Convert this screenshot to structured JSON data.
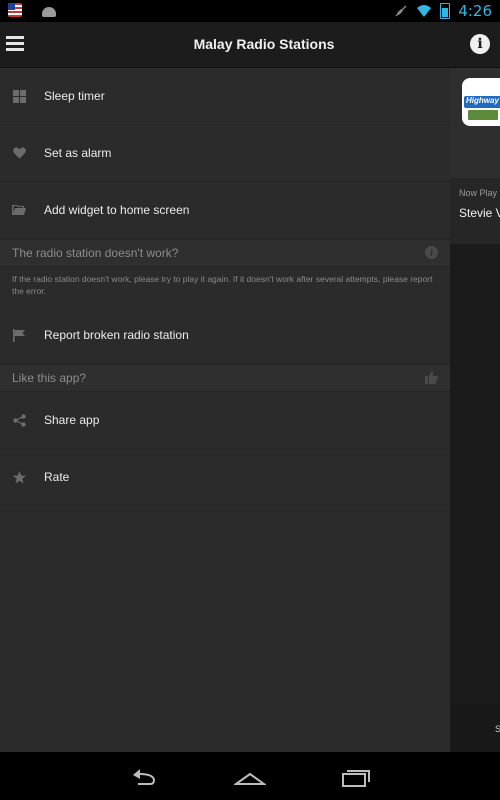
{
  "status_bar": {
    "time": "4:26",
    "icons": [
      "flag-icon",
      "android-icon",
      "mute-icon",
      "wifi-icon",
      "battery-icon"
    ]
  },
  "action_bar": {
    "title": "Malay Radio Stations",
    "menu_icon": "hamburger-menu-icon",
    "info_icon": "info-icon",
    "info_glyph": "i"
  },
  "drawer": {
    "items_top": [
      {
        "label": "Sleep timer",
        "icon": "grid-icon"
      },
      {
        "label": "Set as alarm",
        "icon": "heart-icon"
      },
      {
        "label": "Add widget to home screen",
        "icon": "folder-icon"
      }
    ],
    "broken_section": {
      "header": "The radio station doesn't work?",
      "description": "If the radio station doesn't work, please try to play it again. If it doesn't work after several attempts, please report the error.",
      "item": {
        "label": "Report broken radio station",
        "icon": "flag-icon"
      }
    },
    "like_section": {
      "header": "Like this app?",
      "items": [
        {
          "label": "Share app",
          "icon": "share-icon"
        },
        {
          "label": "Rate",
          "icon": "star-icon"
        }
      ]
    }
  },
  "right_panel": {
    "station_logo_text": "Highway F",
    "now_playing_label": "Now Play",
    "now_playing_track": "Stevie V",
    "bottom_text": "S"
  },
  "nav_bar": {
    "buttons": [
      "back-icon",
      "home-icon",
      "recents-icon"
    ]
  },
  "colors": {
    "accent": "#33b5e5",
    "drawer_bg": "#2b2b2b",
    "action_bar_bg": "#1c1c1c"
  }
}
